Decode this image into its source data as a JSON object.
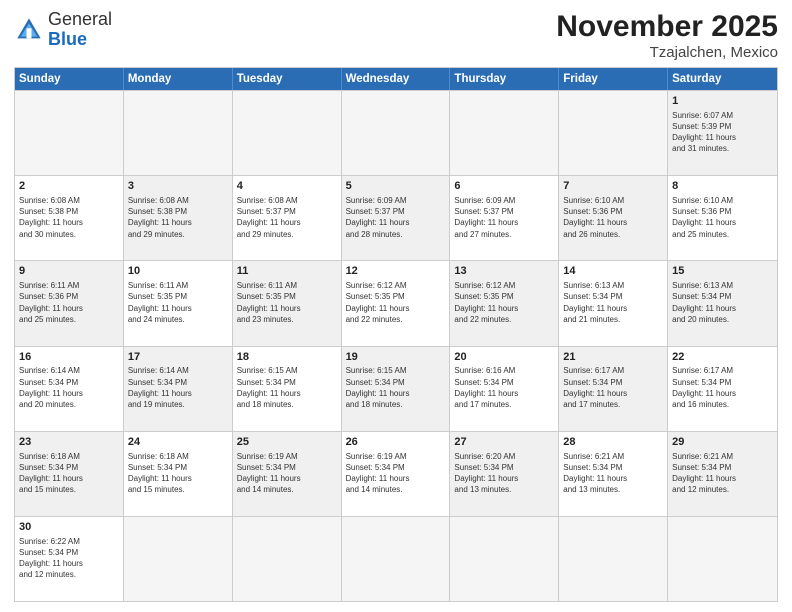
{
  "header": {
    "logo_general": "General",
    "logo_blue": "Blue",
    "month": "November 2025",
    "location": "Tzajalchen, Mexico"
  },
  "days_of_week": [
    "Sunday",
    "Monday",
    "Tuesday",
    "Wednesday",
    "Thursday",
    "Friday",
    "Saturday"
  ],
  "weeks": [
    {
      "cells": [
        {
          "day": "",
          "info": "",
          "empty": true
        },
        {
          "day": "",
          "info": "",
          "empty": true
        },
        {
          "day": "",
          "info": "",
          "empty": true
        },
        {
          "day": "",
          "info": "",
          "empty": true
        },
        {
          "day": "",
          "info": "",
          "empty": true
        },
        {
          "day": "",
          "info": "",
          "empty": true
        },
        {
          "day": "1",
          "info": "Sunrise: 6:07 AM\nSunset: 5:39 PM\nDaylight: 11 hours\nand 31 minutes.",
          "shaded": true
        }
      ]
    },
    {
      "cells": [
        {
          "day": "2",
          "info": "Sunrise: 6:08 AM\nSunset: 5:38 PM\nDaylight: 11 hours\nand 30 minutes."
        },
        {
          "day": "3",
          "info": "Sunrise: 6:08 AM\nSunset: 5:38 PM\nDaylight: 11 hours\nand 29 minutes.",
          "shaded": true
        },
        {
          "day": "4",
          "info": "Sunrise: 6:08 AM\nSunset: 5:37 PM\nDaylight: 11 hours\nand 29 minutes."
        },
        {
          "day": "5",
          "info": "Sunrise: 6:09 AM\nSunset: 5:37 PM\nDaylight: 11 hours\nand 28 minutes.",
          "shaded": true
        },
        {
          "day": "6",
          "info": "Sunrise: 6:09 AM\nSunset: 5:37 PM\nDaylight: 11 hours\nand 27 minutes."
        },
        {
          "day": "7",
          "info": "Sunrise: 6:10 AM\nSunset: 5:36 PM\nDaylight: 11 hours\nand 26 minutes.",
          "shaded": true
        },
        {
          "day": "8",
          "info": "Sunrise: 6:10 AM\nSunset: 5:36 PM\nDaylight: 11 hours\nand 25 minutes."
        }
      ]
    },
    {
      "cells": [
        {
          "day": "9",
          "info": "Sunrise: 6:11 AM\nSunset: 5:36 PM\nDaylight: 11 hours\nand 25 minutes.",
          "shaded": true
        },
        {
          "day": "10",
          "info": "Sunrise: 6:11 AM\nSunset: 5:35 PM\nDaylight: 11 hours\nand 24 minutes."
        },
        {
          "day": "11",
          "info": "Sunrise: 6:11 AM\nSunset: 5:35 PM\nDaylight: 11 hours\nand 23 minutes.",
          "shaded": true
        },
        {
          "day": "12",
          "info": "Sunrise: 6:12 AM\nSunset: 5:35 PM\nDaylight: 11 hours\nand 22 minutes."
        },
        {
          "day": "13",
          "info": "Sunrise: 6:12 AM\nSunset: 5:35 PM\nDaylight: 11 hours\nand 22 minutes.",
          "shaded": true
        },
        {
          "day": "14",
          "info": "Sunrise: 6:13 AM\nSunset: 5:34 PM\nDaylight: 11 hours\nand 21 minutes."
        },
        {
          "day": "15",
          "info": "Sunrise: 6:13 AM\nSunset: 5:34 PM\nDaylight: 11 hours\nand 20 minutes.",
          "shaded": true
        }
      ]
    },
    {
      "cells": [
        {
          "day": "16",
          "info": "Sunrise: 6:14 AM\nSunset: 5:34 PM\nDaylight: 11 hours\nand 20 minutes."
        },
        {
          "day": "17",
          "info": "Sunrise: 6:14 AM\nSunset: 5:34 PM\nDaylight: 11 hours\nand 19 minutes.",
          "shaded": true
        },
        {
          "day": "18",
          "info": "Sunrise: 6:15 AM\nSunset: 5:34 PM\nDaylight: 11 hours\nand 18 minutes."
        },
        {
          "day": "19",
          "info": "Sunrise: 6:15 AM\nSunset: 5:34 PM\nDaylight: 11 hours\nand 18 minutes.",
          "shaded": true
        },
        {
          "day": "20",
          "info": "Sunrise: 6:16 AM\nSunset: 5:34 PM\nDaylight: 11 hours\nand 17 minutes."
        },
        {
          "day": "21",
          "info": "Sunrise: 6:17 AM\nSunset: 5:34 PM\nDaylight: 11 hours\nand 17 minutes.",
          "shaded": true
        },
        {
          "day": "22",
          "info": "Sunrise: 6:17 AM\nSunset: 5:34 PM\nDaylight: 11 hours\nand 16 minutes."
        }
      ]
    },
    {
      "cells": [
        {
          "day": "23",
          "info": "Sunrise: 6:18 AM\nSunset: 5:34 PM\nDaylight: 11 hours\nand 15 minutes.",
          "shaded": true
        },
        {
          "day": "24",
          "info": "Sunrise: 6:18 AM\nSunset: 5:34 PM\nDaylight: 11 hours\nand 15 minutes."
        },
        {
          "day": "25",
          "info": "Sunrise: 6:19 AM\nSunset: 5:34 PM\nDaylight: 11 hours\nand 14 minutes.",
          "shaded": true
        },
        {
          "day": "26",
          "info": "Sunrise: 6:19 AM\nSunset: 5:34 PM\nDaylight: 11 hours\nand 14 minutes."
        },
        {
          "day": "27",
          "info": "Sunrise: 6:20 AM\nSunset: 5:34 PM\nDaylight: 11 hours\nand 13 minutes.",
          "shaded": true
        },
        {
          "day": "28",
          "info": "Sunrise: 6:21 AM\nSunset: 5:34 PM\nDaylight: 11 hours\nand 13 minutes."
        },
        {
          "day": "29",
          "info": "Sunrise: 6:21 AM\nSunset: 5:34 PM\nDaylight: 11 hours\nand 12 minutes.",
          "shaded": true
        }
      ]
    },
    {
      "cells": [
        {
          "day": "30",
          "info": "Sunrise: 6:22 AM\nSunset: 5:34 PM\nDaylight: 11 hours\nand 12 minutes."
        },
        {
          "day": "",
          "info": "",
          "empty": true
        },
        {
          "day": "",
          "info": "",
          "empty": true
        },
        {
          "day": "",
          "info": "",
          "empty": true
        },
        {
          "day": "",
          "info": "",
          "empty": true
        },
        {
          "day": "",
          "info": "",
          "empty": true
        },
        {
          "day": "",
          "info": "",
          "empty": true
        }
      ]
    }
  ]
}
